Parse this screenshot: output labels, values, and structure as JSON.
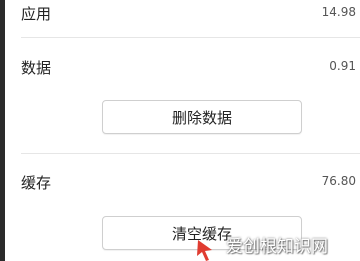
{
  "rows": {
    "app": {
      "label": "应用",
      "value": "14.98"
    },
    "data": {
      "label": "数据",
      "value": "0.91"
    },
    "cache": {
      "label": "缓存",
      "value": "76.80"
    }
  },
  "buttons": {
    "delete_data": "删除数据",
    "clear_cache": "清空缓存"
  },
  "watermark": {
    "text": "爱创根知识网",
    "accent": "#e03c31"
  },
  "colors": {
    "edge": "#2b2b2b",
    "divider": "#e6e6e6",
    "button_border": "#cfcfcf"
  }
}
